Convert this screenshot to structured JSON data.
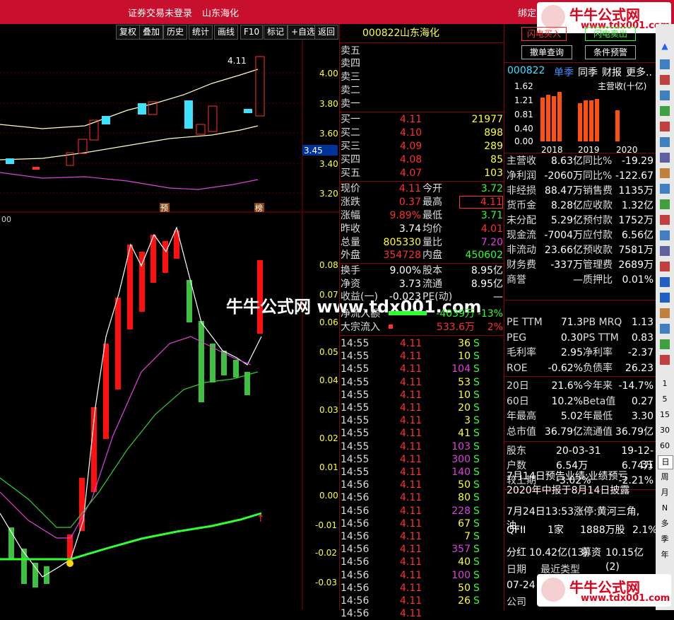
{
  "titlebar": {
    "status": "证券交易未登录",
    "stock": "山东海化",
    "bind": "绑定"
  },
  "watermark": {
    "brand": "牛牛公式网",
    "url": "www.tdx001.com",
    "center": "牛牛公式网 www.tdx001.com"
  },
  "toolbar": [
    "复权",
    "叠加",
    "历史",
    "统计",
    "画线",
    "F10",
    "标记",
    "+自选",
    "返回"
  ],
  "chart": {
    "top_price_label": "4.11",
    "price_ticks": [
      "4.00",
      "3.80",
      "3.60",
      "3.40",
      "3.20"
    ],
    "current_price_tag": "3.45",
    "markers": [
      "预",
      "榜"
    ],
    "lower_ticks": [
      "0.08",
      "0.07",
      "0.06",
      "0.05",
      "0.04",
      "0.03",
      "0.02",
      "0.01",
      "0.00",
      "-0.01",
      "-0.02",
      "-0.03"
    ],
    "lower_left_label": "00"
  },
  "quote": {
    "code": "000822",
    "name": "山东海化",
    "sell": [
      {
        "l": "卖五"
      },
      {
        "l": "卖四"
      },
      {
        "l": "卖三"
      },
      {
        "l": "卖二"
      },
      {
        "l": "卖一"
      }
    ],
    "buy": [
      {
        "l": "买一",
        "p": "4.11",
        "v": "21977"
      },
      {
        "l": "买二",
        "p": "4.10",
        "v": "898"
      },
      {
        "l": "买三",
        "p": "4.09",
        "v": "289"
      },
      {
        "l": "买四",
        "p": "4.08",
        "v": "85"
      },
      {
        "l": "买五",
        "p": "4.07",
        "v": "103"
      }
    ],
    "stats": [
      {
        "l1": "现价",
        "v1": "4.11",
        "l2": "今开",
        "v2": "3.72"
      },
      {
        "l1": "涨跌",
        "v1": "0.37",
        "l2": "最高",
        "v2": "4.11"
      },
      {
        "l1": "涨幅",
        "v1": "9.89%",
        "l2": "最低",
        "v2": "3.71"
      },
      {
        "l1": "昨收",
        "v1": "3.74",
        "l2": "均价",
        "v2": "4.01"
      },
      {
        "l1": "总量",
        "v1": "805330",
        "l2": "量比",
        "v2": "7.20"
      },
      {
        "l1": "外盘",
        "v1": "354728",
        "l2": "内盘",
        "v2": "450602"
      }
    ],
    "stats2": [
      {
        "l1": "换手",
        "v1": "9.00%",
        "l2": "股本",
        "v2": "8.95亿"
      },
      {
        "l1": "净资",
        "v1": "3.73",
        "l2": "流通",
        "v2": "8.95亿"
      },
      {
        "l1": "收益(一)",
        "v1": "-0.023",
        "l2": "PE(动)",
        "v2": "—"
      }
    ],
    "flow": [
      {
        "l": "净流入额",
        "v": "-4039万",
        "p": "-13%"
      },
      {
        "l": "大宗流入",
        "v": "533.6万",
        "p": "2%"
      }
    ],
    "ticks": [
      {
        "t": "14:55",
        "p": "4.11",
        "v": "36",
        "s": "S"
      },
      {
        "t": "14:55",
        "p": "4.11",
        "v": "10",
        "s": "S"
      },
      {
        "t": "14:55",
        "p": "4.11",
        "v": "104",
        "s": "S"
      },
      {
        "t": "14:55",
        "p": "4.11",
        "v": "53",
        "s": "S"
      },
      {
        "t": "14:55",
        "p": "4.11",
        "v": "10",
        "s": "S"
      },
      {
        "t": "14:55",
        "p": "4.11",
        "v": "20",
        "s": "S"
      },
      {
        "t": "14:55",
        "p": "4.11",
        "v": "3",
        "s": "S"
      },
      {
        "t": "14:55",
        "p": "4.11",
        "v": "41",
        "s": "S"
      },
      {
        "t": "14:55",
        "p": "4.11",
        "v": "103",
        "s": "S"
      },
      {
        "t": "14:55",
        "p": "4.11",
        "v": "300",
        "s": "S"
      },
      {
        "t": "14:55",
        "p": "4.11",
        "v": "140",
        "s": "S"
      },
      {
        "t": "14:56",
        "p": "4.11",
        "v": "50",
        "s": "S"
      },
      {
        "t": "14:56",
        "p": "4.11",
        "v": "80",
        "s": "S"
      },
      {
        "t": "14:56",
        "p": "4.11",
        "v": "228",
        "s": "S"
      },
      {
        "t": "14:56",
        "p": "4.11",
        "v": "67",
        "s": "S"
      },
      {
        "t": "14:56",
        "p": "4.11",
        "v": "7",
        "s": "S"
      },
      {
        "t": "14:56",
        "p": "4.11",
        "v": "357",
        "s": "S"
      },
      {
        "t": "14:56",
        "p": "4.11",
        "v": "40",
        "s": "S"
      },
      {
        "t": "14:56",
        "p": "4.11",
        "v": "100",
        "s": "S"
      },
      {
        "t": "14:56",
        "p": "4.11",
        "v": "50",
        "s": "S"
      },
      {
        "t": "14:56",
        "p": "4.11",
        "v": "26",
        "s": "S"
      },
      {
        "t": "14:56",
        "p": "4.11",
        "v": "",
        "s": ""
      }
    ]
  },
  "fin": {
    "buttons": [
      "闪电买入",
      "闪电卖出",
      "撤单查询",
      "条件预警"
    ],
    "tabs": {
      "code": "000822",
      "t1": "单季",
      "t2": "同季",
      "t3": "财报",
      "t4": "更多.."
    },
    "revenue_chart": {
      "title": "主营收(十亿)",
      "y": [
        "1.62",
        "1.21",
        "0.81",
        "0.40",
        "0.00"
      ],
      "years": [
        "2018",
        "2019",
        "2020"
      ]
    },
    "rows": [
      [
        "主营收",
        "8.63亿",
        "同比%",
        "-19.29"
      ],
      [
        "净利润",
        "-2060万",
        "同比%",
        "-122.67"
      ],
      [
        "非经损",
        "88.47万",
        "销售费",
        "1135万"
      ],
      [
        "货币金",
        "8.28亿",
        "应收款",
        "1.32亿"
      ],
      [
        "未分配",
        "5.29亿",
        "预付款",
        "1752万"
      ],
      [
        "现金流",
        "-7004万",
        "应付款",
        "6.56亿"
      ],
      [
        "非流动",
        "23.66亿",
        "预收款",
        "7581万"
      ],
      [
        "财务费",
        "-337万",
        "管理费",
        "2689万"
      ],
      [
        "商誉",
        "—",
        "质押比",
        "0.01%"
      ]
    ],
    "val": [
      [
        "PE TTM",
        "71.3",
        "PB MRQ",
        "1.13"
      ],
      [
        "PEG",
        "0.30",
        "PS TTM",
        "0.83"
      ],
      [
        "毛利率",
        "2.95",
        "净利率",
        "-2.37"
      ],
      [
        "ROE",
        "-0.62%",
        "负债率",
        "26.23"
      ]
    ],
    "perf": [
      [
        "20日",
        "21.6%",
        "今年来",
        "-14.7%"
      ],
      [
        "60日",
        "10.2%",
        "Beta值",
        "0.27"
      ],
      [
        "年最高",
        "5.02",
        "年最低",
        "3.30"
      ],
      [
        "总市值",
        "36.79亿",
        "流通值",
        "36.79亿"
      ]
    ],
    "holders": [
      [
        "股东",
        "",
        "20-03-31",
        "19-12-31"
      ],
      [
        "户数",
        "",
        "6.54万",
        "6.74万"
      ],
      [
        "较上期",
        "",
        "-3.02%",
        "-2.21%"
      ]
    ],
    "news": [
      "7月14日预告业绩:业绩预亏",
      "2020年中报于8月14日披露",
      "7月24日13:53涨停:黄河三角,油..."
    ],
    "qfii": [
      "QFII",
      "1家",
      "1888万股",
      "2.1%"
    ],
    "div": [
      "分红",
      "10.42亿(13)",
      "募资",
      "10.15亿(2)"
    ],
    "date_row": [
      "日期",
      "最近类型"
    ],
    "date_val": "07-24",
    "company": "公司"
  },
  "rside": [
    "日",
    "周",
    "月",
    "N",
    "多",
    "季",
    "年",
    "1",
    "5",
    "15",
    "30",
    "60"
  ]
}
